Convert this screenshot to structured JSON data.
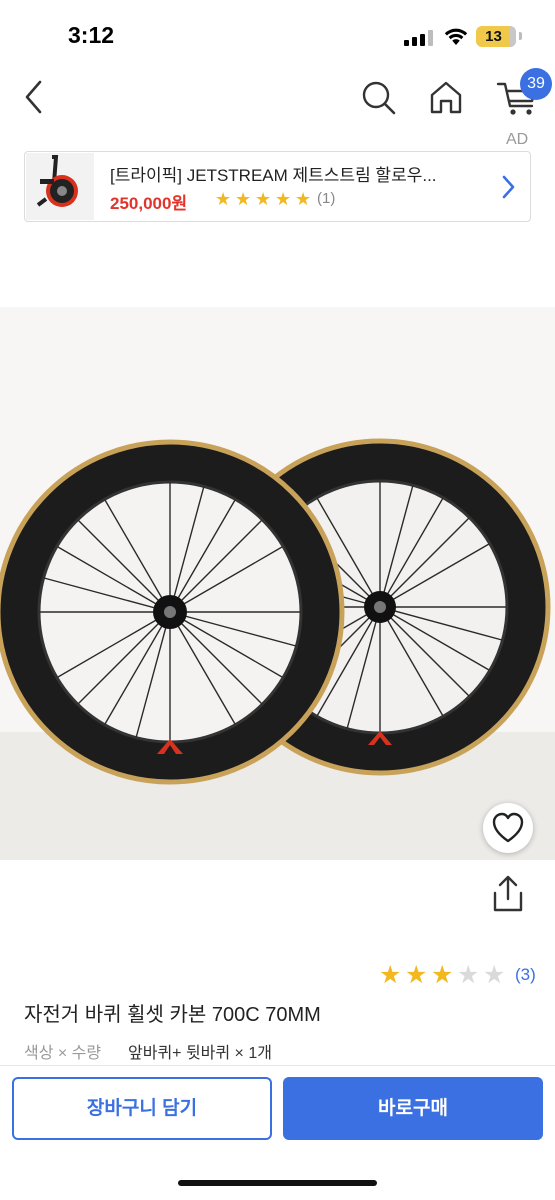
{
  "status_bar": {
    "time": "3:12",
    "battery": "13"
  },
  "nav": {
    "back_icon": "chevron-left-icon",
    "search_icon": "search-icon",
    "home_icon": "home-icon",
    "cart_icon": "cart-icon",
    "cart_badge": "39",
    "accent_color": "#3b70e2"
  },
  "ad": {
    "label": "AD",
    "title": "[트라이픽] JETSTREAM 제트스트림 할로우...",
    "price": "250,000원",
    "rating_stars": 5,
    "review_count": "(1)",
    "price_color": "#e2342a"
  },
  "product": {
    "rating": 3,
    "rating_max": 5,
    "review_count": "(3)",
    "title": "자전거 바퀴 휠셋 카본 700C 70MM",
    "option_label": "색상 × 수량",
    "option_value": "앞바퀴+ 뒷바퀴 × 1개",
    "star_color": "#f3b81d"
  },
  "actions": {
    "cart_label": "장바구니 담기",
    "buy_label": "바로구매"
  }
}
